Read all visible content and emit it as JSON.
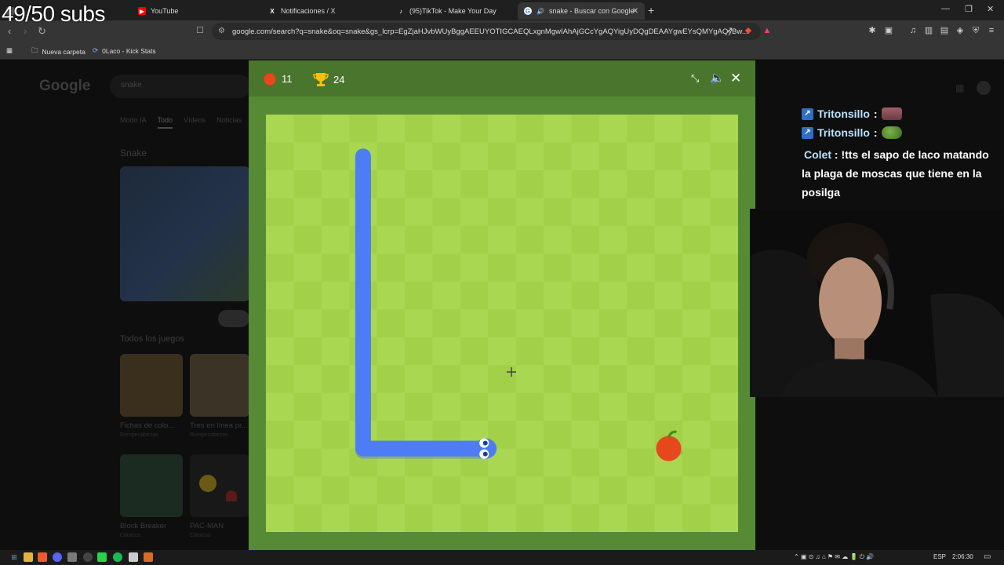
{
  "overlay": {
    "subs_counter": "49/50 subs"
  },
  "browser": {
    "tabs": [
      {
        "title": "YouTube",
        "icon": "youtube-icon",
        "active": false
      },
      {
        "title": "Notificaciones / X",
        "icon": "x-icon",
        "active": false
      },
      {
        "title": "(95)TikTok - Make Your Day",
        "icon": "tiktok-icon",
        "active": false
      },
      {
        "title": "snake - Buscar con Google",
        "icon": "google-icon",
        "active": true
      }
    ],
    "url": "google.com/search?q=snake&oq=snake&gs_lcrp=EgZjaHJvbWUyBggAEEUYOTIGCAEQLxgnMgwIAhAjGCcYgAQYigUyDQgDEAAYgwEYsQMYgAQyBw...",
    "bookmarks": [
      {
        "label": "Nueva carpeta",
        "icon": "folder-icon"
      },
      {
        "label": "0Laco - Kick Stats",
        "icon": "kick-stats-icon"
      }
    ]
  },
  "google_bg": {
    "logo": "Google",
    "search_value": "snake",
    "tabs": [
      "Modo IA",
      "Todo",
      "Vídeos",
      "Noticias"
    ],
    "active_tab": "Todo",
    "section_title": "Snake",
    "games_heading": "Todos los juegos",
    "games": [
      {
        "title": "Fichas de colo...",
        "sub": "Rompecabezas"
      },
      {
        "title": "Tres en línea pr...",
        "sub": "Rompecabezas"
      },
      {
        "title": "Block Breaker",
        "sub": "Clásicos"
      },
      {
        "title": "PAC-MAN",
        "sub": "Clásicos"
      }
    ]
  },
  "game": {
    "score": "11",
    "high_score": "24",
    "colors": {
      "frame": "#578a34",
      "hud": "#4a752c",
      "tile_light": "#aad751",
      "tile_dark": "#a2d149",
      "snake": "#4e7cf6",
      "apple": "#e7471d"
    },
    "snake_path": [
      [
        3,
        1
      ],
      [
        3,
        11.5
      ],
      [
        7.3,
        11.5
      ]
    ],
    "apple_cell": [
      14,
      11.5
    ]
  },
  "chat": {
    "messages": [
      {
        "user": "Tritonsillo",
        "text": "",
        "emote": "emote-icon"
      },
      {
        "user": "Tritonsillo",
        "text": "",
        "emote": "pepe-emote-icon"
      },
      {
        "user": "Colet",
        "text": "!tts el sapo de laco matando la plaga de moscas que tiene en la posilga",
        "emote": ""
      }
    ]
  },
  "taskbar": {
    "language": "ESP",
    "time": "2:06:30"
  }
}
